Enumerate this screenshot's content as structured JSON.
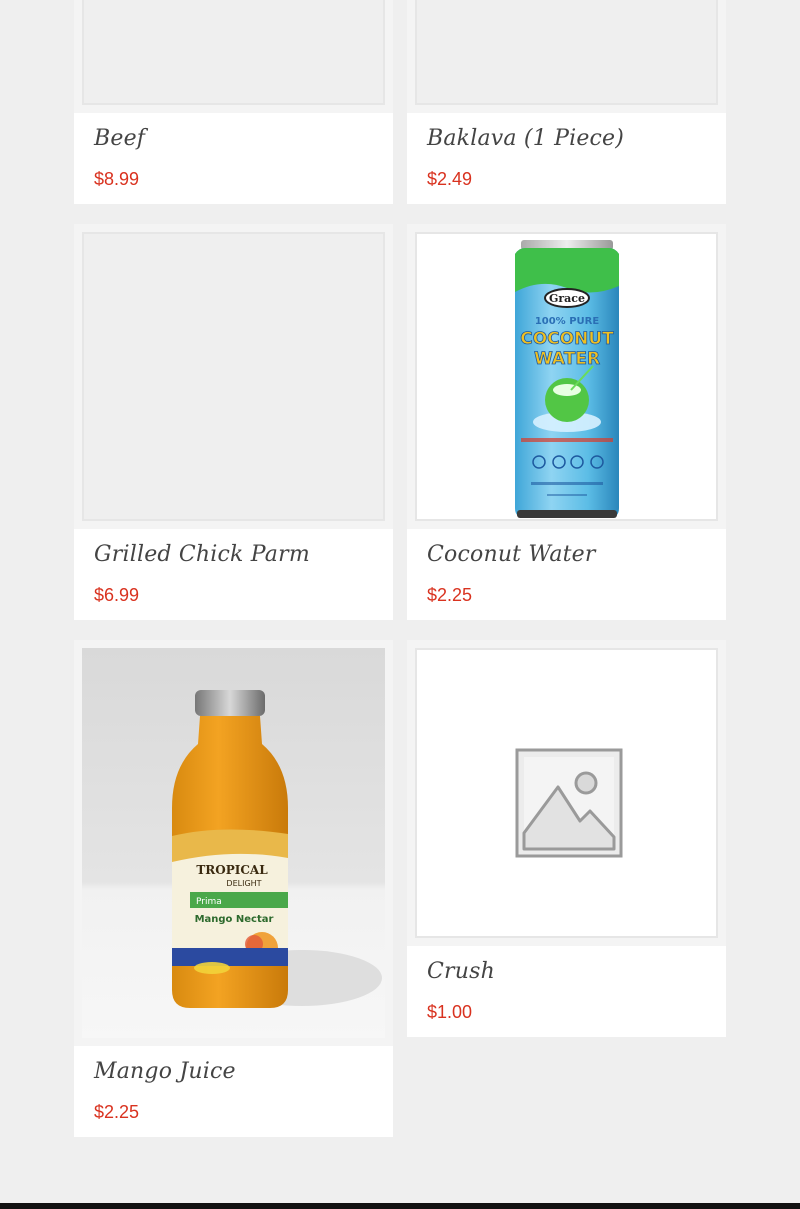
{
  "products": [
    {
      "name": "Beef",
      "price": "$8.99",
      "image": "placeholder-gray"
    },
    {
      "name": "Baklava (1 Piece)",
      "price": "$2.49",
      "image": "placeholder-gray"
    },
    {
      "name": "Grilled Chick Parm",
      "price": "$6.99",
      "image": "placeholder-gray"
    },
    {
      "name": "Coconut Water",
      "price": "$2.25",
      "image": "coconut-water-can",
      "image_label": {
        "brand": "Grace",
        "line1": "100% PURE",
        "line2": "COCONUT",
        "line3": "WATER"
      }
    },
    {
      "name": "Crush",
      "price": "$1.00",
      "image": "image-placeholder-icon"
    },
    {
      "name": "Mango Juice",
      "price": "$2.25",
      "image": "mango-juice-bottle",
      "image_label": {
        "brand": "TROPICAL",
        "brand2": "DELIGHT",
        "tag": "Prima",
        "product": "Mango Nectar"
      }
    }
  ],
  "colors": {
    "background": "#efefef",
    "card": "#ffffff",
    "price": "#d9321f",
    "title": "#444444"
  }
}
